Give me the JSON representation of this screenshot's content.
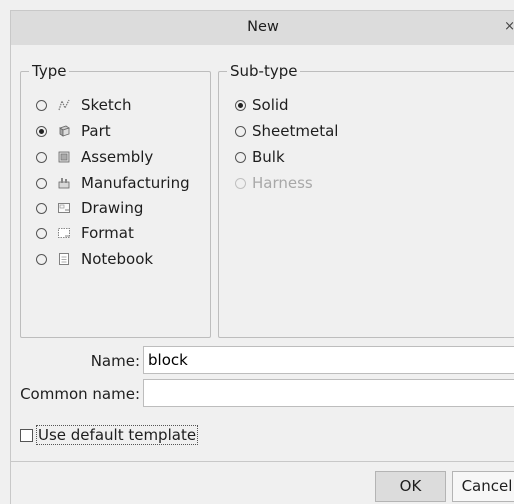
{
  "dialog": {
    "title": "New",
    "close_glyph": "×"
  },
  "type_group": {
    "legend": "Type",
    "options": [
      {
        "label": "Sketch",
        "icon": "sketch-icon",
        "selected": false
      },
      {
        "label": "Part",
        "icon": "part-icon",
        "selected": true
      },
      {
        "label": "Assembly",
        "icon": "assembly-icon",
        "selected": false
      },
      {
        "label": "Manufacturing",
        "icon": "manufacturing-icon",
        "selected": false
      },
      {
        "label": "Drawing",
        "icon": "drawing-icon",
        "selected": false
      },
      {
        "label": "Format",
        "icon": "format-icon",
        "selected": false
      },
      {
        "label": "Notebook",
        "icon": "notebook-icon",
        "selected": false
      }
    ]
  },
  "subtype_group": {
    "legend": "Sub-type",
    "options": [
      {
        "label": "Solid",
        "selected": true,
        "enabled": true
      },
      {
        "label": "Sheetmetal",
        "selected": false,
        "enabled": true
      },
      {
        "label": "Bulk",
        "selected": false,
        "enabled": true
      },
      {
        "label": "Harness",
        "selected": false,
        "enabled": false
      }
    ]
  },
  "fields": {
    "name_label": "Name:",
    "name_value": "block",
    "common_name_label": "Common name:",
    "common_name_value": ""
  },
  "template": {
    "label": "Use default template",
    "checked": false
  },
  "buttons": {
    "ok": "OK",
    "cancel": "Cancel"
  }
}
